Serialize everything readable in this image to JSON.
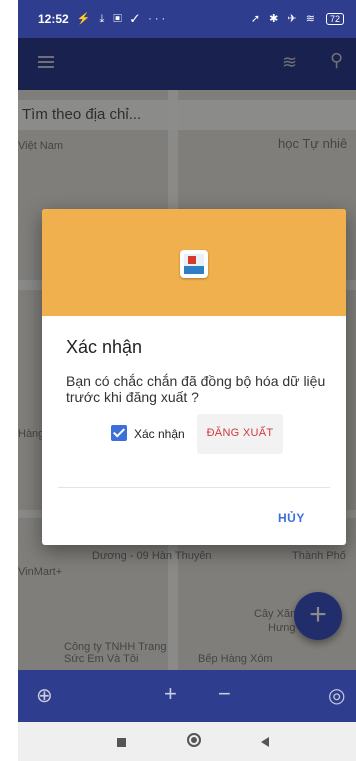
{
  "status": {
    "time": "12:52",
    "left_icons": "⚡ ⤓ ▣ ✓ ···",
    "right_icons": "➚ ✱ ✈ ≋",
    "battery": "72"
  },
  "appbar": {
    "menu_icon": "menu-icon",
    "layers_icon": "layers-icon",
    "search_icon": "search-icon"
  },
  "search": {
    "placeholder": "Tìm theo địa chỉ..."
  },
  "map_labels": {
    "vietnam": "Việt Nam",
    "hoc_tu": "học Tự nhiê",
    "hang": "Hàng",
    "duong": "Dương - 09 Hàn Thuyên",
    "thanhpho": "Thành Phố",
    "vinmart": "VinMart+",
    "cayxang": "Cây Xăng",
    "hung": "Hưng",
    "congty": "Công ty TNHH Trang",
    "suc_em": "Sức Em Và Tôi",
    "bephang": "Bếp Hàng Xóm"
  },
  "dialog": {
    "title": "Xác nhận",
    "message": "Bạn có chắc chắn đã đồng bộ hóa dữ liệu trước khi đăng xuất ?",
    "checkbox_label": "Xác nhận",
    "checkbox_checked": true,
    "logout_label": "ĐĂNG XUẤT",
    "cancel_label": "HỦY",
    "header_color": "#f0b04e"
  },
  "fab": {
    "label": "+"
  },
  "bottombar": {
    "plus": "+",
    "minus": "−"
  },
  "colors": {
    "primary": "#2f3d8e",
    "accent": "#3b6fd9",
    "danger": "#d23a3a"
  }
}
